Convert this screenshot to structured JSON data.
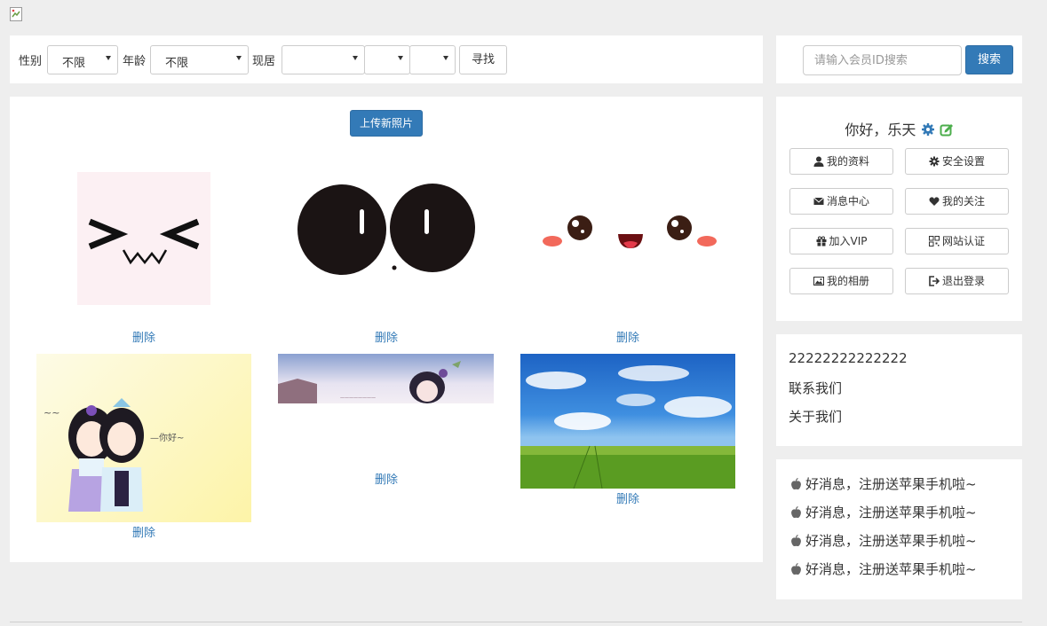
{
  "filter": {
    "gender_label": "性别",
    "gender_value": "不限",
    "age_label": "年龄",
    "age_value": "不限",
    "residence_label": "现居",
    "province_value": "",
    "city_value": "",
    "district_value": "",
    "find_button": "寻找"
  },
  "search": {
    "placeholder": "请输入会员ID搜索",
    "button": "搜索"
  },
  "gallery": {
    "upload_button": "上传新照片",
    "photos": [
      {
        "name": "emoticon-squint",
        "delete_label": "删除"
      },
      {
        "name": "emoticon-big-eyes",
        "delete_label": "删除"
      },
      {
        "name": "emoticon-blush",
        "delete_label": "删除"
      },
      {
        "name": "anime-couple",
        "delete_label": "删除"
      },
      {
        "name": "anime-banner",
        "delete_label": "删除"
      },
      {
        "name": "sky-field",
        "delete_label": "删除"
      }
    ]
  },
  "user": {
    "greeting": "你好，乐天",
    "buttons": [
      {
        "label": "我的资料",
        "icon": "user-icon"
      },
      {
        "label": "安全设置",
        "icon": "cog-icon"
      },
      {
        "label": "消息中心",
        "icon": "envelope-icon"
      },
      {
        "label": "我的关注",
        "icon": "heart-icon"
      },
      {
        "label": "加入VIP",
        "icon": "gift-icon"
      },
      {
        "label": "网站认证",
        "icon": "qrcode-icon"
      },
      {
        "label": "我的相册",
        "icon": "picture-icon"
      },
      {
        "label": "退出登录",
        "icon": "logout-icon"
      }
    ]
  },
  "links": {
    "items": [
      "22222222222222",
      "联系我们",
      "关于我们"
    ]
  },
  "news": {
    "items": [
      "好消息，注册送苹果手机啦~",
      "好消息，注册送苹果手机啦~",
      "好消息，注册送苹果手机啦~",
      "好消息，注册送苹果手机啦~"
    ]
  },
  "colors": {
    "primary": "#337ab7",
    "background": "#eeeeee",
    "edit_icon": "#4cae4c"
  }
}
